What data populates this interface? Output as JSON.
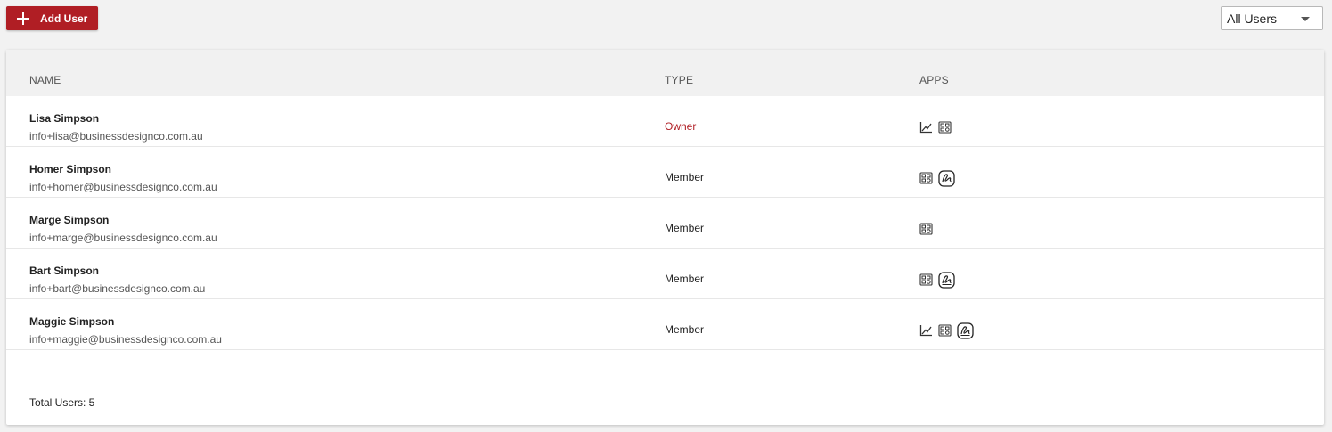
{
  "toolbar": {
    "add_user_label": "Add User",
    "filter_value": "All Users"
  },
  "table": {
    "headers": {
      "name": "NAME",
      "type": "TYPE",
      "apps": "APPS"
    },
    "rows": [
      {
        "name": "Lisa Simpson",
        "email": "info+lisa@businessdesignco.com.au",
        "type": "Owner",
        "apps": [
          "chart-icon",
          "dashboard-icon"
        ]
      },
      {
        "name": "Homer Simpson",
        "email": "info+homer@businessdesignco.com.au",
        "type": "Member",
        "apps": [
          "dashboard-icon",
          "sign-icon"
        ]
      },
      {
        "name": "Marge Simpson",
        "email": "info+marge@businessdesignco.com.au",
        "type": "Member",
        "apps": [
          "dashboard-icon"
        ]
      },
      {
        "name": "Bart Simpson",
        "email": "info+bart@businessdesignco.com.au",
        "type": "Member",
        "apps": [
          "dashboard-icon",
          "sign-icon"
        ]
      },
      {
        "name": "Maggie Simpson",
        "email": "info+maggie@businessdesignco.com.au",
        "type": "Member",
        "apps": [
          "chart-icon",
          "dashboard-icon",
          "sign-icon"
        ]
      }
    ]
  },
  "footer": {
    "total_label": "Total Users: 5"
  },
  "colors": {
    "accent": "#b01e24",
    "owner_text": "#b01e24"
  }
}
